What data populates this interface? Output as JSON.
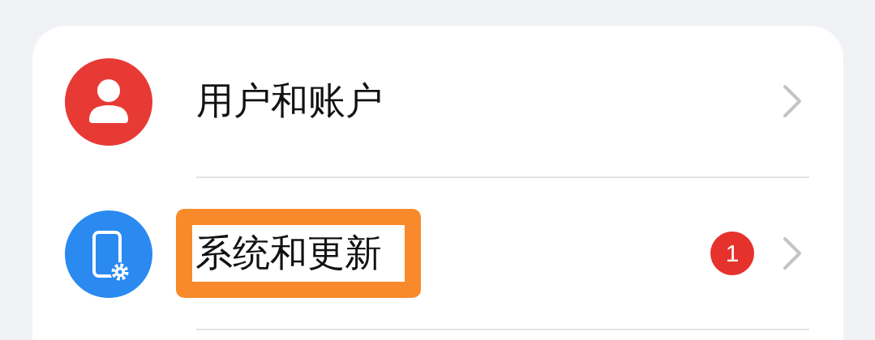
{
  "settings_items": [
    {
      "kind": "account",
      "label": "用户和账户",
      "highlighted": false
    },
    {
      "kind": "system",
      "label": "系统和更新",
      "highlighted": true,
      "badge": "1"
    }
  ]
}
